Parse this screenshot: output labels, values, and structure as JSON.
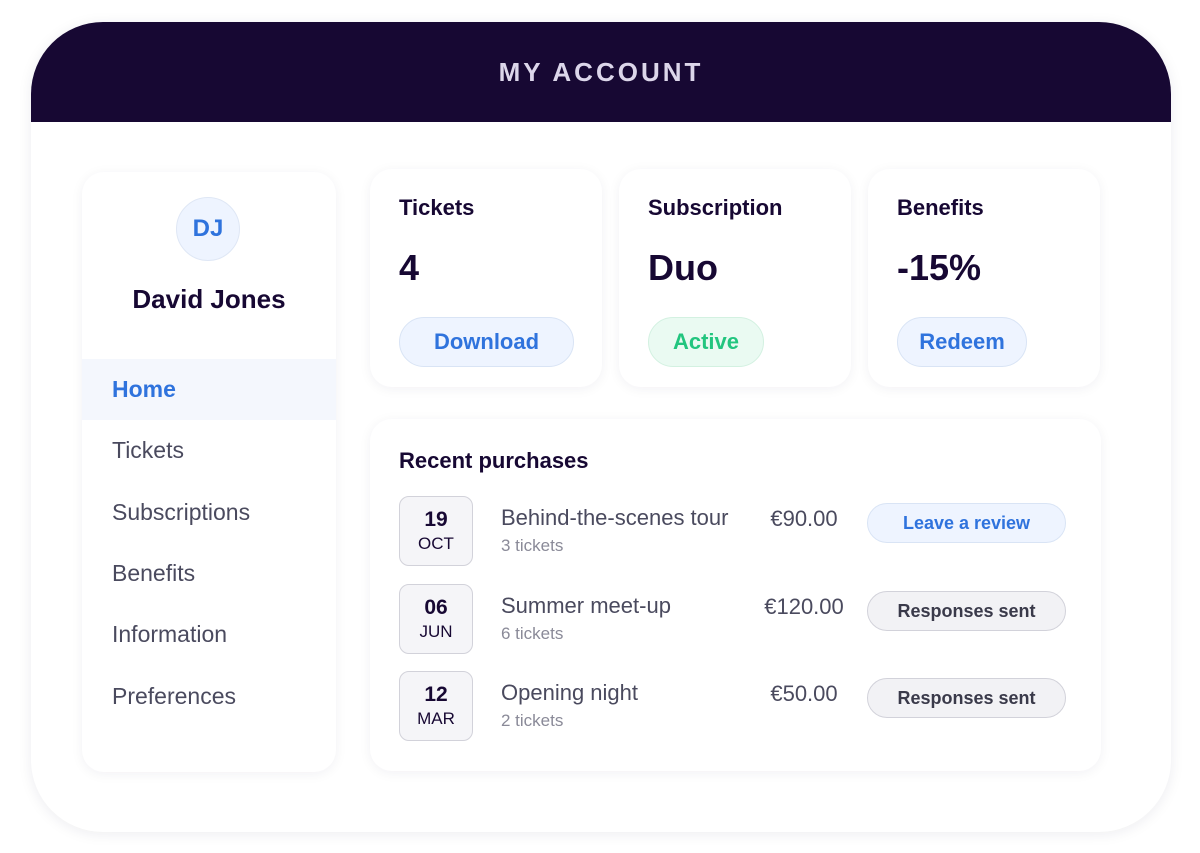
{
  "header": {
    "title": "MY ACCOUNT"
  },
  "profile": {
    "initials": "DJ",
    "name": "David Jones"
  },
  "nav": {
    "items": [
      {
        "label": "Home",
        "active": true
      },
      {
        "label": "Tickets",
        "active": false
      },
      {
        "label": "Subscriptions",
        "active": false
      },
      {
        "label": "Benefits",
        "active": false
      },
      {
        "label": "Information",
        "active": false
      },
      {
        "label": "Preferences",
        "active": false
      }
    ]
  },
  "stats": {
    "tickets": {
      "label": "Tickets",
      "value": "4",
      "action": "Download"
    },
    "subscription": {
      "label": "Subscription",
      "value": "Duo",
      "status": "Active"
    },
    "benefits": {
      "label": "Benefits",
      "value": "-15%",
      "action": "Redeem"
    }
  },
  "purchases": {
    "title": "Recent purchases",
    "rows": [
      {
        "day": "19",
        "month": "OCT",
        "title": "Behind-the-scenes tour",
        "tickets": "3 tickets",
        "price": "€90.00",
        "action": "Leave a review"
      },
      {
        "day": "06",
        "month": "JUN",
        "title": "Summer meet-up",
        "tickets": "6 tickets",
        "price": "€120.00",
        "action": "Responses sent"
      },
      {
        "day": "12",
        "month": "MAR",
        "title": "Opening night",
        "tickets": "2 tickets",
        "price": "€50.00",
        "action": "Responses sent"
      }
    ]
  },
  "colors": {
    "header_bg": "#170833",
    "accent_blue": "#2f73dd",
    "accent_green": "#22c57f",
    "text_dark": "#170833"
  }
}
